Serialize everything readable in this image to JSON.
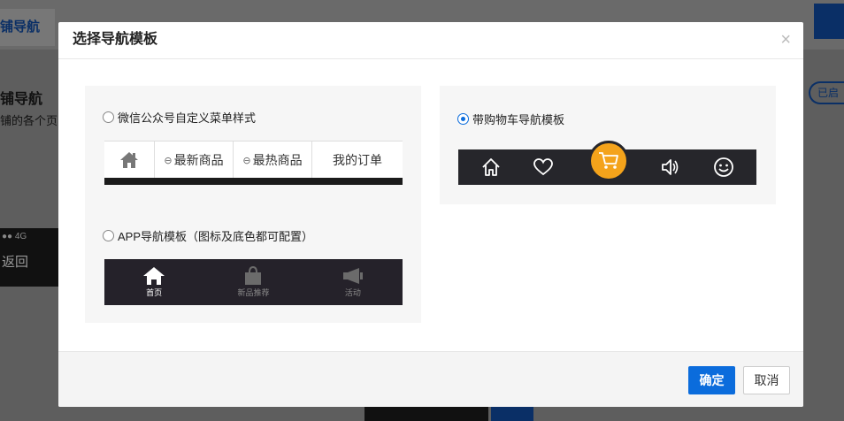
{
  "background": {
    "tab_label": "铺导航",
    "title": "铺导航",
    "subtitle": "铺的各个页",
    "badge": "已启",
    "phone_signal": "●● 4G",
    "phone_back": "返回"
  },
  "dialog": {
    "title": "选择导航模板",
    "close_symbol": "×",
    "options": [
      {
        "label": "微信公众号自定义菜单样式",
        "selected": false,
        "menu": [
          "最新商品",
          "最热商品",
          "我的订单"
        ]
      },
      {
        "label": "APP导航模板（图标及底色都可配置）",
        "selected": false,
        "items": [
          "首页",
          "新品推荐",
          "活动"
        ]
      },
      {
        "label": "带购物车导航模板",
        "selected": true,
        "icons": [
          "home-icon",
          "heart-icon",
          "cart-icon",
          "speaker-icon",
          "smile-icon"
        ]
      }
    ],
    "confirm_label": "确定",
    "cancel_label": "取消"
  },
  "colors": {
    "primary": "#0b6cdc",
    "cart_accent": "#f4a31b",
    "preview_dark": "#26262b"
  }
}
